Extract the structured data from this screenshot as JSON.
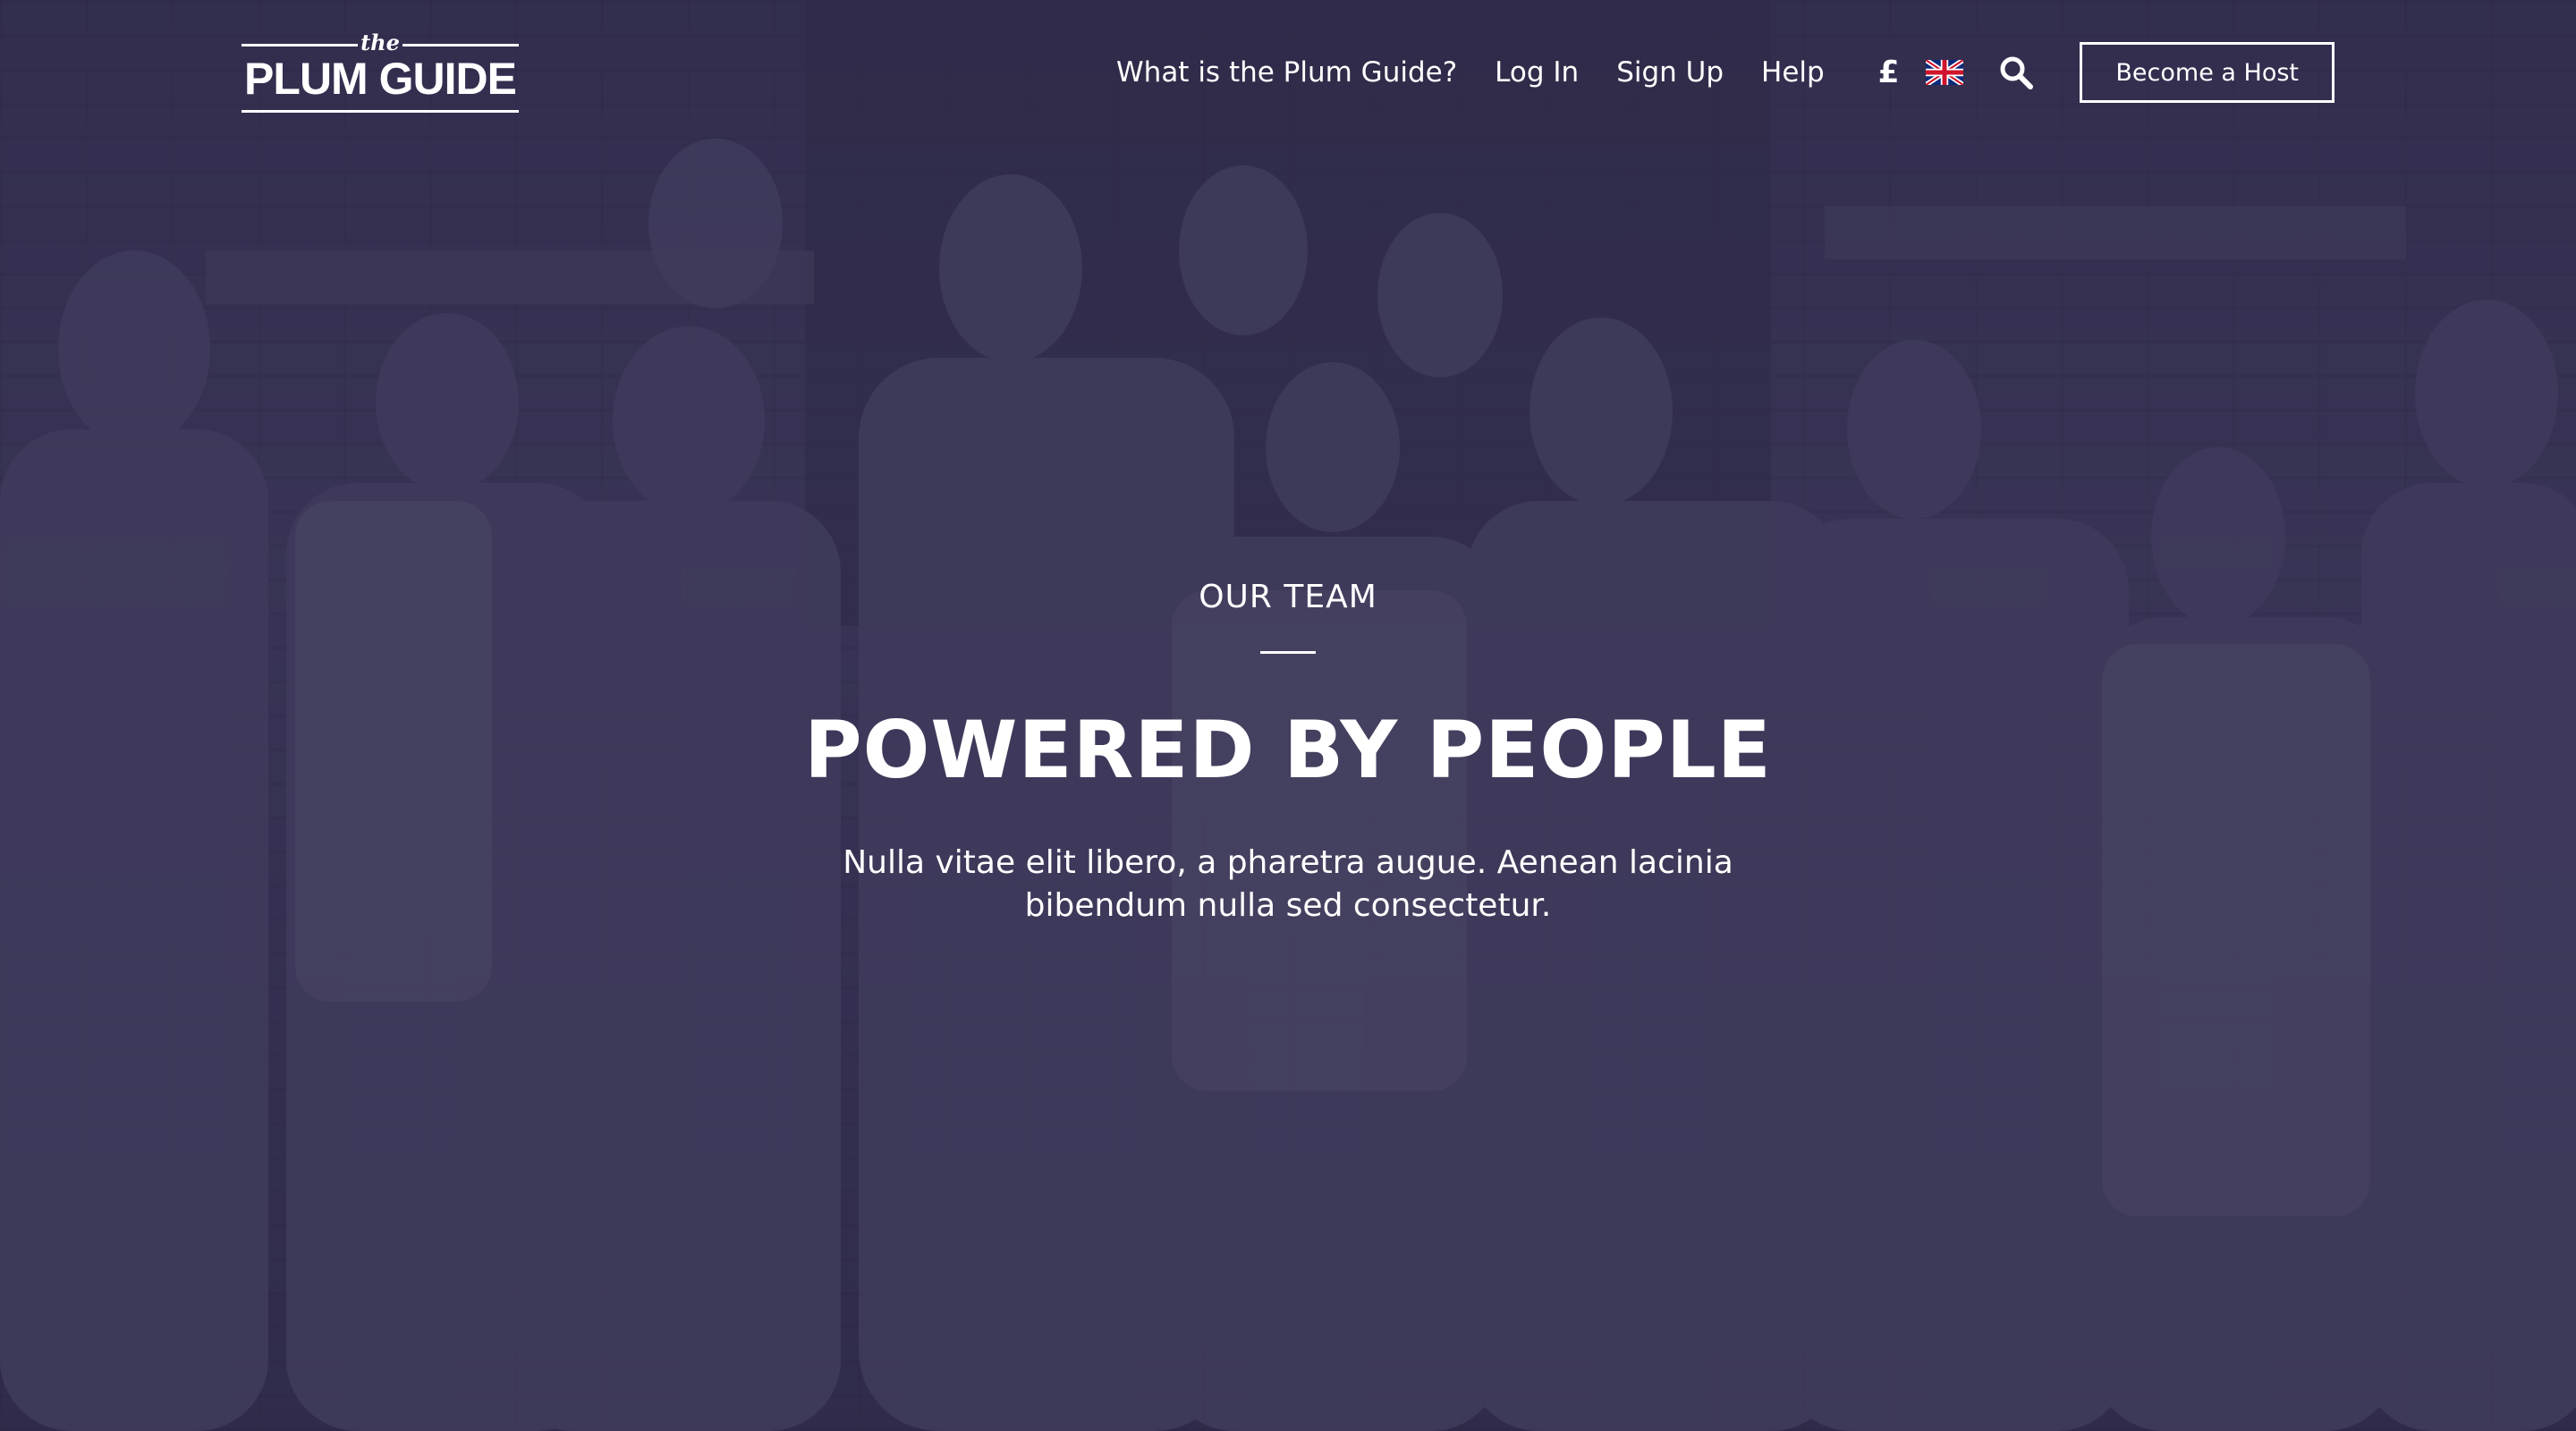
{
  "header": {
    "logo": {
      "small_text": "the",
      "brand_text": "PLUM GUIDE"
    },
    "nav": {
      "links": [
        {
          "label": "What is the Plum Guide?"
        },
        {
          "label": "Log In"
        },
        {
          "label": "Sign Up"
        },
        {
          "label": "Help"
        }
      ],
      "currency_symbol": "£",
      "language_flag_icon": "uk-flag-icon",
      "search_icon": "search-icon",
      "cta_label": "Become a Host"
    }
  },
  "hero": {
    "eyebrow": "OUR TEAM",
    "title": "POWERED BY PEOPLE",
    "subtitle": "Nulla vitae elit libero, a pharetra augue. Aenean lacinia bibendum nulla sed consectetur."
  },
  "colors": {
    "overlay": "#262142",
    "text": "#ffffff"
  }
}
